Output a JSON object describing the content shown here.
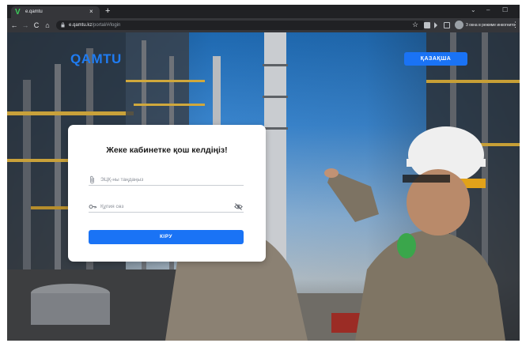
{
  "browser": {
    "tab": {
      "title": "e.qamtu",
      "favicon": "v-logo-icon",
      "close_label": "×"
    },
    "new_tab_label": "+",
    "window_controls": {
      "chevron": "⌄",
      "minimize": "–",
      "maximize": "☐"
    },
    "nav": {
      "back": "←",
      "forward": "→",
      "reload": "C",
      "home": "⌂"
    },
    "url": {
      "host": "e.qamtu.kz",
      "path": "/portal/#/login"
    },
    "incognito_text": "3 окна в режиме инкогнито",
    "menu": "⋮",
    "star": "☆"
  },
  "header": {
    "brand": "QAMTU",
    "language_button": "ҚАЗАҚША"
  },
  "login": {
    "title": "Жеке кабинетке қош келдіңіз!",
    "eds_placeholder": "ЭЦҚ-ны таңдаңыз",
    "password_placeholder": "Құпия сөз",
    "submit_label": "КІРУ"
  },
  "colors": {
    "accent": "#1a73f5",
    "brand": "#1f7cf2",
    "favicon": "#3ccf5a"
  }
}
